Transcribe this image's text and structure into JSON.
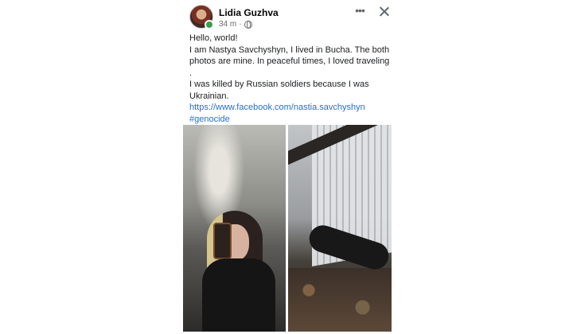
{
  "post": {
    "author": "Lidia Guzhva",
    "time": "34 m",
    "text_lines": [
      "Hello, world!",
      "I am Nastya Savchyshyn, I lived in Bucha. The both photos are mine. In peaceful times, I loved traveling .",
      "I was killed by Russian soldiers because I was Ukrainian."
    ],
    "profile_link": "https://www.facebook.com/nastia.savchyshyn",
    "hashtag": "#genocide"
  },
  "icons": {
    "more": "more-options-icon",
    "close": "close-icon",
    "audience": "globe-icon",
    "online": "online-status-dot"
  },
  "colors": {
    "author": "#050505",
    "link": "#216fdb",
    "secondary_text": "#65676b",
    "online": "#31a24c"
  }
}
